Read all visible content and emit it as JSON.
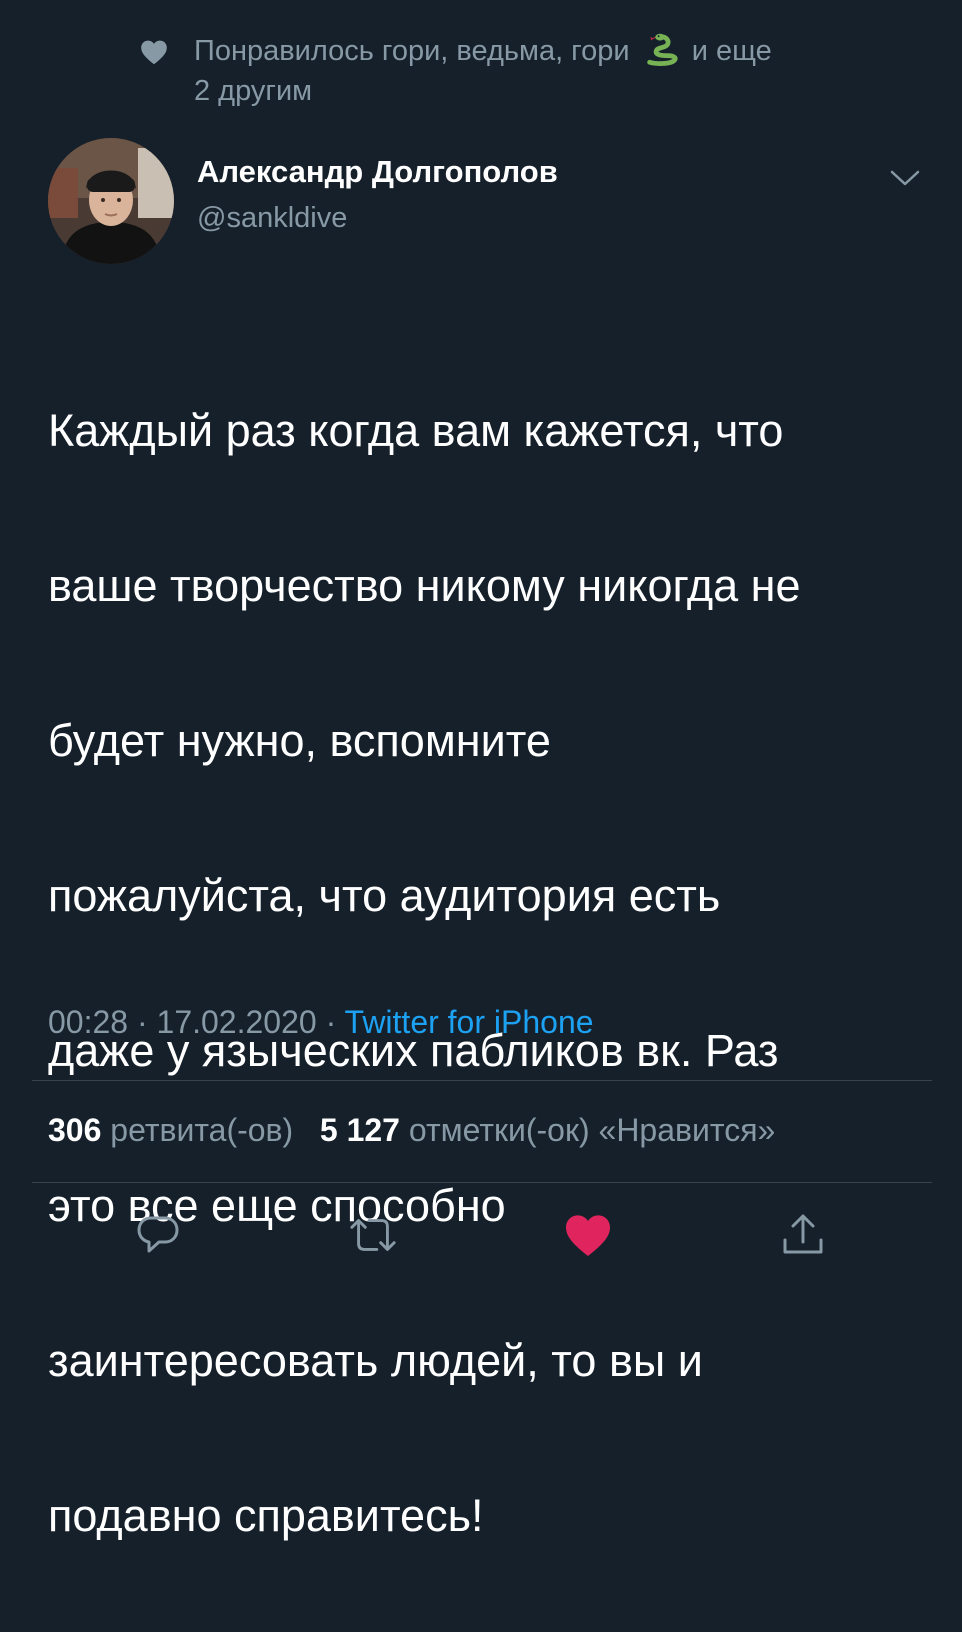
{
  "social_context": {
    "prefix": "Понравилось гори, ведьма, гори",
    "suffix": "и еще",
    "line2": "2 другим",
    "icon": "heart-icon",
    "emoji": "snake-emoji"
  },
  "author": {
    "name": "Александр Долгополов",
    "handle": "@sankldive",
    "avatar": "avatar-photo",
    "menu_icon": "chevron-down-icon"
  },
  "tweet": {
    "lines": [
      "Каждый раз когда вам кажется, что",
      "ваше творчество никому никогда не",
      "будет нужно, вспомните",
      "пожалуйста, что аудитория есть",
      "даже у языческих пабликов вк. Раз",
      "это все еще способно",
      "заинтересовать людей, то вы и",
      "подавно справитесь!"
    ],
    "time": "00:28",
    "date": "17.02.2020",
    "separator": "·",
    "source": "Twitter for iPhone"
  },
  "stats": {
    "retweets_count": "306",
    "retweets_label": "ретвита(-ов)",
    "likes_count": "5 127",
    "likes_label": "отметки(-ок) «Нравится»"
  },
  "actions": [
    {
      "name": "reply",
      "icon": "reply-icon"
    },
    {
      "name": "retweet",
      "icon": "retweet-icon"
    },
    {
      "name": "like",
      "icon": "heart-icon",
      "liked": true
    },
    {
      "name": "share",
      "icon": "share-icon"
    }
  ],
  "colors": {
    "background": "#15202b",
    "secondary_text": "#8899a6",
    "accent": "#1da1f2",
    "like": "#e0245e",
    "divider": "#38444d"
  }
}
